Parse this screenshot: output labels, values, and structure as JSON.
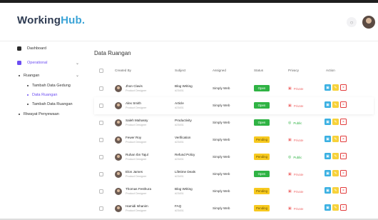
{
  "header": {
    "logo_main": "WorkingHub",
    "logo_accent": "Hub.",
    "logo_prefix": "Working",
    "bell_icon": "bell-icon"
  },
  "sidebar": {
    "dashboard": "Dashboard",
    "operational": "Operational",
    "ruangan": "Ruangan",
    "tambah_data_gedung": "Tambah Data Gedung",
    "data_ruangan": "Data Ruangan",
    "tambah_data_ruangan": "Tambah Data Ruangan",
    "riwayat_penyewaan": "Riwayat Penyewaan"
  },
  "main": {
    "title": "Data Ruangan",
    "columns": [
      "Created By",
      "Subject",
      "Assigned",
      "Status",
      "Privacy",
      "Action"
    ],
    "rows": [
      {
        "name": "Jhon Clavis",
        "role": "Product Designer",
        "subject": "Blog Writing",
        "sid": "#23451",
        "assigned": "Simply Web",
        "status": "Open",
        "status_kind": "open",
        "privacy": "Private",
        "privacy_kind": "private"
      },
      {
        "name": "Alex Smith",
        "role": "Product Designer",
        "subject": "Article",
        "sid": "#23451",
        "assigned": "Simply Web",
        "status": "Open",
        "status_kind": "open",
        "privacy": "Private",
        "privacy_kind": "private"
      },
      {
        "name": "Saleh Mahassy",
        "role": "Product Designer",
        "subject": "Productivity",
        "sid": "#23451",
        "assigned": "Simply Web",
        "status": "Open",
        "status_kind": "open",
        "privacy": "Public",
        "privacy_kind": "public"
      },
      {
        "name": "Fewer Roy",
        "role": "Product Designer",
        "subject": "Verification",
        "sid": "#23451",
        "assigned": "Simply Web",
        "status": "Pending",
        "status_kind": "pending",
        "privacy": "Private",
        "privacy_kind": "private"
      },
      {
        "name": "Ruhan Ibn Tajul",
        "role": "Product Designer",
        "subject": "Refund Policy",
        "sid": "#23451",
        "assigned": "Simply Web",
        "status": "Pending",
        "status_kind": "pending",
        "privacy": "Public",
        "privacy_kind": "public"
      },
      {
        "name": "Elon James",
        "role": "Product Designer",
        "subject": "Lifetime Deals",
        "sid": "#23451",
        "assigned": "Simply Web",
        "status": "Open",
        "status_kind": "open",
        "privacy": "Private",
        "privacy_kind": "private"
      },
      {
        "name": "Thomas Festhura",
        "role": "Product Designer",
        "subject": "Blog Writing",
        "sid": "#23451",
        "assigned": "Simply Web",
        "status": "Pending",
        "status_kind": "pending",
        "privacy": "Private",
        "privacy_kind": "private"
      },
      {
        "name": "Hamidi Ishanim",
        "role": "Product Designer",
        "subject": "FAQ",
        "sid": "#23451",
        "assigned": "Simply Web",
        "status": "Pending",
        "status_kind": "pending",
        "privacy": "Private",
        "privacy_kind": "private"
      }
    ]
  },
  "colors": {
    "accent": "#6c4df2",
    "open": "#2fb344",
    "pending": "#f7c91f",
    "private": "#ef6b6b",
    "view": "#3ab0e2",
    "edit": "#f7d23a",
    "delete": "#e23b3b"
  }
}
